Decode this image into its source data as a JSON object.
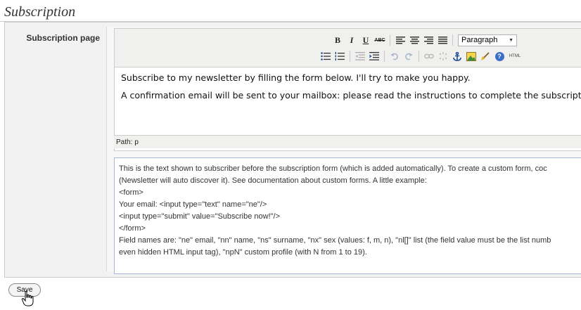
{
  "section": {
    "title": "Subscription"
  },
  "row": {
    "label": "Subscription page"
  },
  "editor": {
    "toolbar": {
      "row1": {
        "bold": "B",
        "italic": "I",
        "underline": "U",
        "strikethrough": "ABC",
        "block_format": "Paragraph"
      },
      "row2_icons": [
        "bullet-list-icon",
        "numbered-list-icon",
        "outdent-icon",
        "indent-icon",
        "undo-icon",
        "redo-icon",
        "link-icon",
        "unlink-icon",
        "anchor-icon",
        "image-icon",
        "cleanup-icon",
        "help-icon",
        "html-icon"
      ],
      "html_label": "HTML",
      "help_glyph": "?"
    },
    "content": [
      "Subscribe to my newsletter by filling the form below. I'll try to make you happy.",
      "A confirmation email will be sent to your mailbox: please read the instructions to complete the subscription."
    ],
    "path_label": "Path:",
    "path_value": "p"
  },
  "help_text": {
    "lines": [
      "This is the text shown to subscriber before the subscription form (which is added automatically). To create a custom form, coc",
      "(Newsletter will auto discover it). See documentation about custom forms. A little example:",
      "<form>",
      "Your email: <input type=\"text\" name=\"ne\"/>",
      "<input type=\"submit\" value=\"Subscribe now!\"/>",
      "</form>",
      "Field names are: \"ne\" email, \"nn\" name, \"ns\" surname, \"nx\" sex (values: f, m, n), \"nl[]\" list (the field value must be the list numb",
      "even hidden HTML input tag), \"npN\" custom profile (with N from 1 to 19)."
    ]
  },
  "actions": {
    "save_label": "Save"
  },
  "colors": {
    "editor_toolbar_bg": "#f0f0ee",
    "help_border": "#a6b8d6",
    "form_bg": "#f2f2f2",
    "help_icon_bg": "#3a6fc9"
  }
}
